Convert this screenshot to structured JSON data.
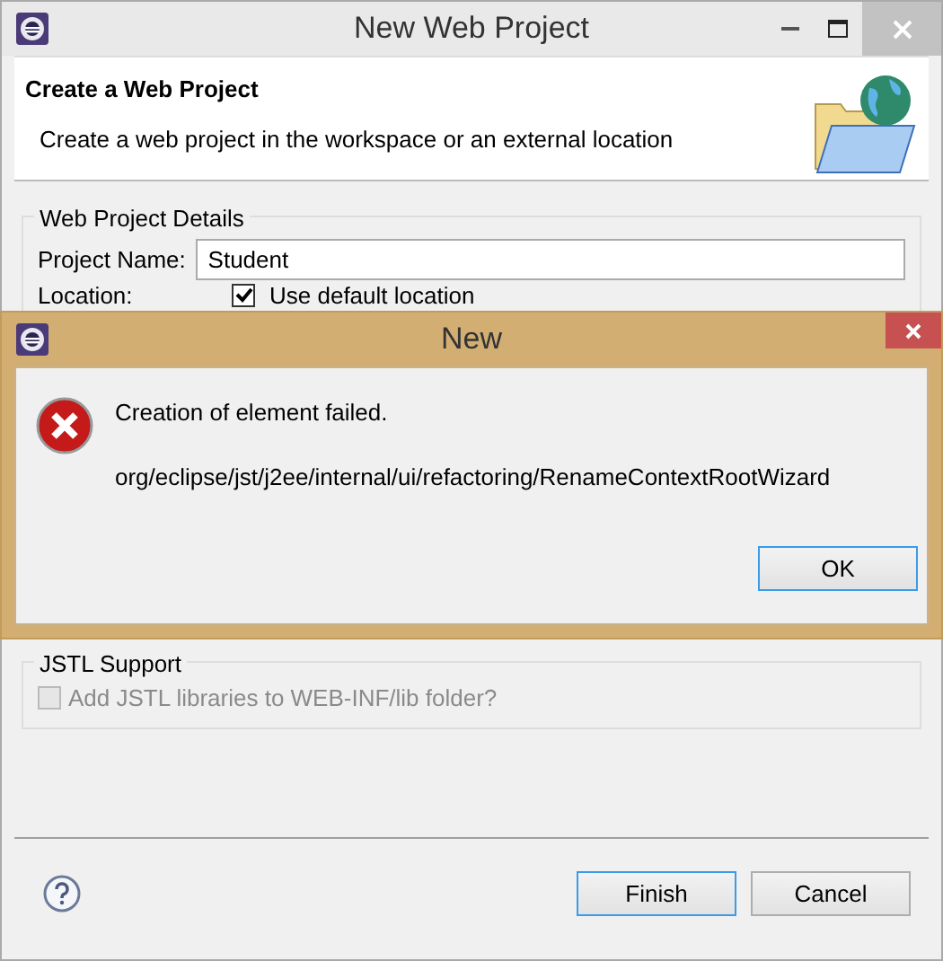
{
  "window": {
    "title": "New Web Project"
  },
  "header": {
    "title": "Create a Web Project",
    "description": "Create a web project in the workspace or an external location"
  },
  "details_group": {
    "title": "Web Project Details",
    "project_name": {
      "label": "Project Name:",
      "value": "Student"
    },
    "location": {
      "label": "Location:",
      "use_default": {
        "label": "Use default location",
        "checked": true
      }
    }
  },
  "jstl_group": {
    "title": "JSTL Support",
    "add_libraries": {
      "label": "Add JSTL libraries to WEB-INF/lib folder?",
      "checked": false,
      "disabled": true
    }
  },
  "buttons": [
    {
      "label": "Finish",
      "default": true
    },
    {
      "label": "Cancel",
      "default": false
    }
  ],
  "error_dialog": {
    "title": "New",
    "message": "Creation of element failed.",
    "detail": "org/eclipse/jst/j2ee/internal/ui/refactoring/RenameContextRootWizard",
    "buttons": [
      {
        "label": "OK",
        "default": true
      }
    ]
  }
}
